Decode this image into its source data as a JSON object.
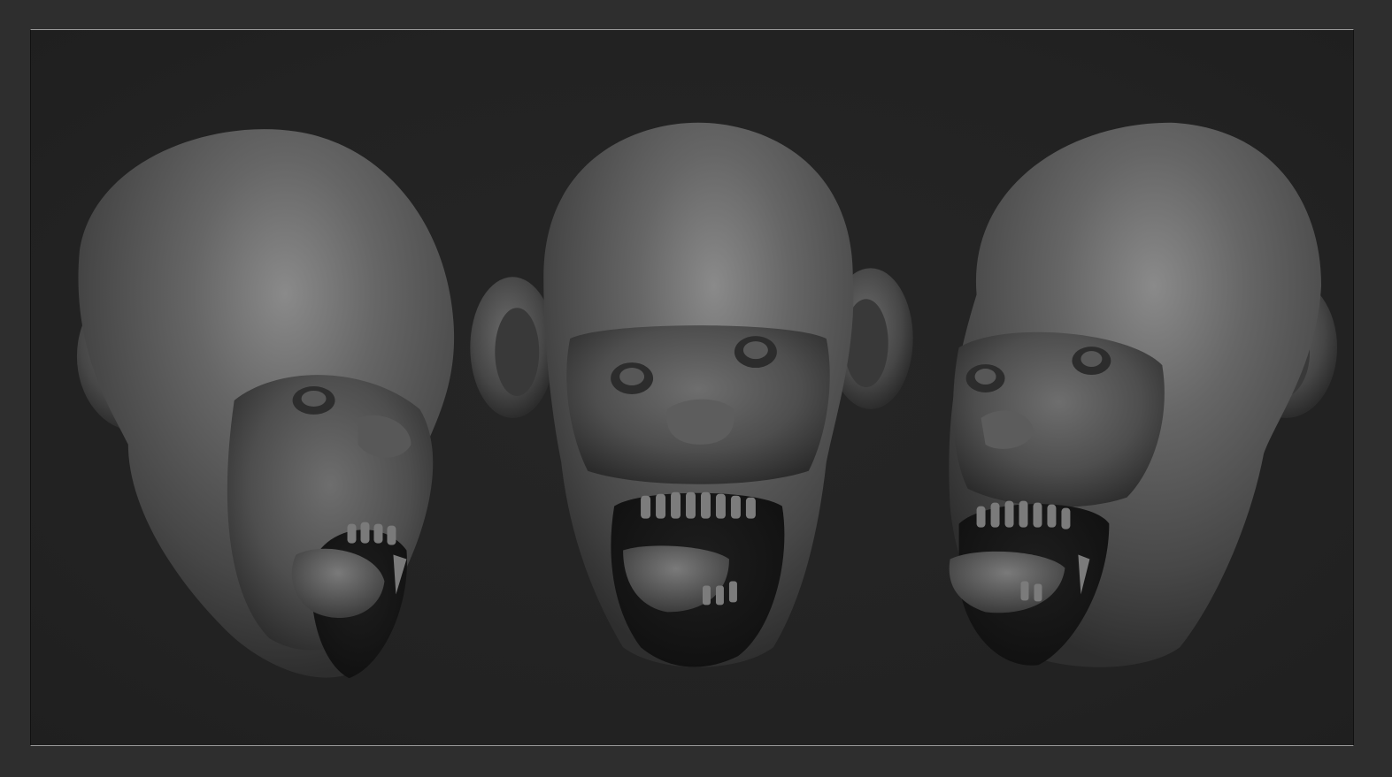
{
  "scene": {
    "background_color": "#232323",
    "frame_color": "#2e2e2e",
    "border_line_color": "#9a9a9a",
    "material_color": "#5c5c5c",
    "views": [
      {
        "name": "three-quarter-left-view"
      },
      {
        "name": "front-view"
      },
      {
        "name": "three-quarter-right-view"
      }
    ]
  }
}
